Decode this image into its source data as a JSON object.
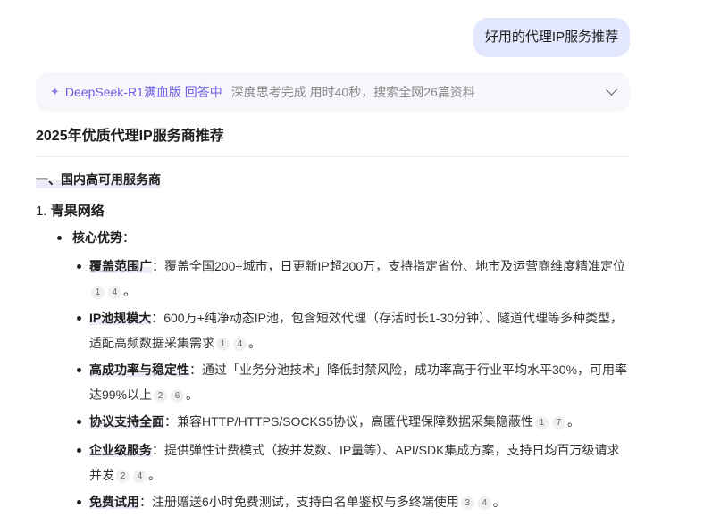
{
  "user_message": "好用的代理IP服务推荐",
  "think": {
    "model": "DeepSeek-R1满血版 回答中",
    "status": "深度思考完成 用时40秒，搜索全网26篇资料"
  },
  "answer": {
    "title": "2025年优质代理IP服务商推荐",
    "section": "一、国内高可用服务商",
    "provider_num": "1.",
    "provider_name": "青果网络",
    "core_label": "核心优势",
    "core_colon": "：",
    "items": [
      {
        "label": "覆盖范围广",
        "text": "：覆盖全国200+城市，日更新IP超200万，支持指定省份、地市及运营商维度精准定位",
        "refs": [
          "1",
          "4"
        ]
      },
      {
        "label": "IP池规模大",
        "text": "：600万+纯净动态IP池，包含短效代理（存活时长1-30分钟）、隧道代理等多种类型，适配高频数据采集需求",
        "refs": [
          "1",
          "4"
        ]
      },
      {
        "label": "高成功率与稳定性",
        "text": "：通过「业务分池技术」降低封禁风险，成功率高于行业平均水平30%，可用率达99%以上",
        "refs": [
          "2",
          "6"
        ]
      },
      {
        "label": "协议支持全面",
        "text": "：兼容HTTP/HTTPS/SOCKS5协议，高匿代理保障数据采集隐蔽性",
        "refs": [
          "1",
          "7"
        ]
      },
      {
        "label": "企业级服务",
        "text": "：提供弹性计费模式（按并发数、IP量等）、API/SDK集成方案，支持日均百万级请求并发",
        "refs": [
          "2",
          "4"
        ]
      },
      {
        "label": "免费试用",
        "text": "：注册赠送6小时免费测试，支持白名单鉴权与多终端使用",
        "refs": [
          "3",
          "4"
        ]
      }
    ],
    "end_mark": "。"
  }
}
